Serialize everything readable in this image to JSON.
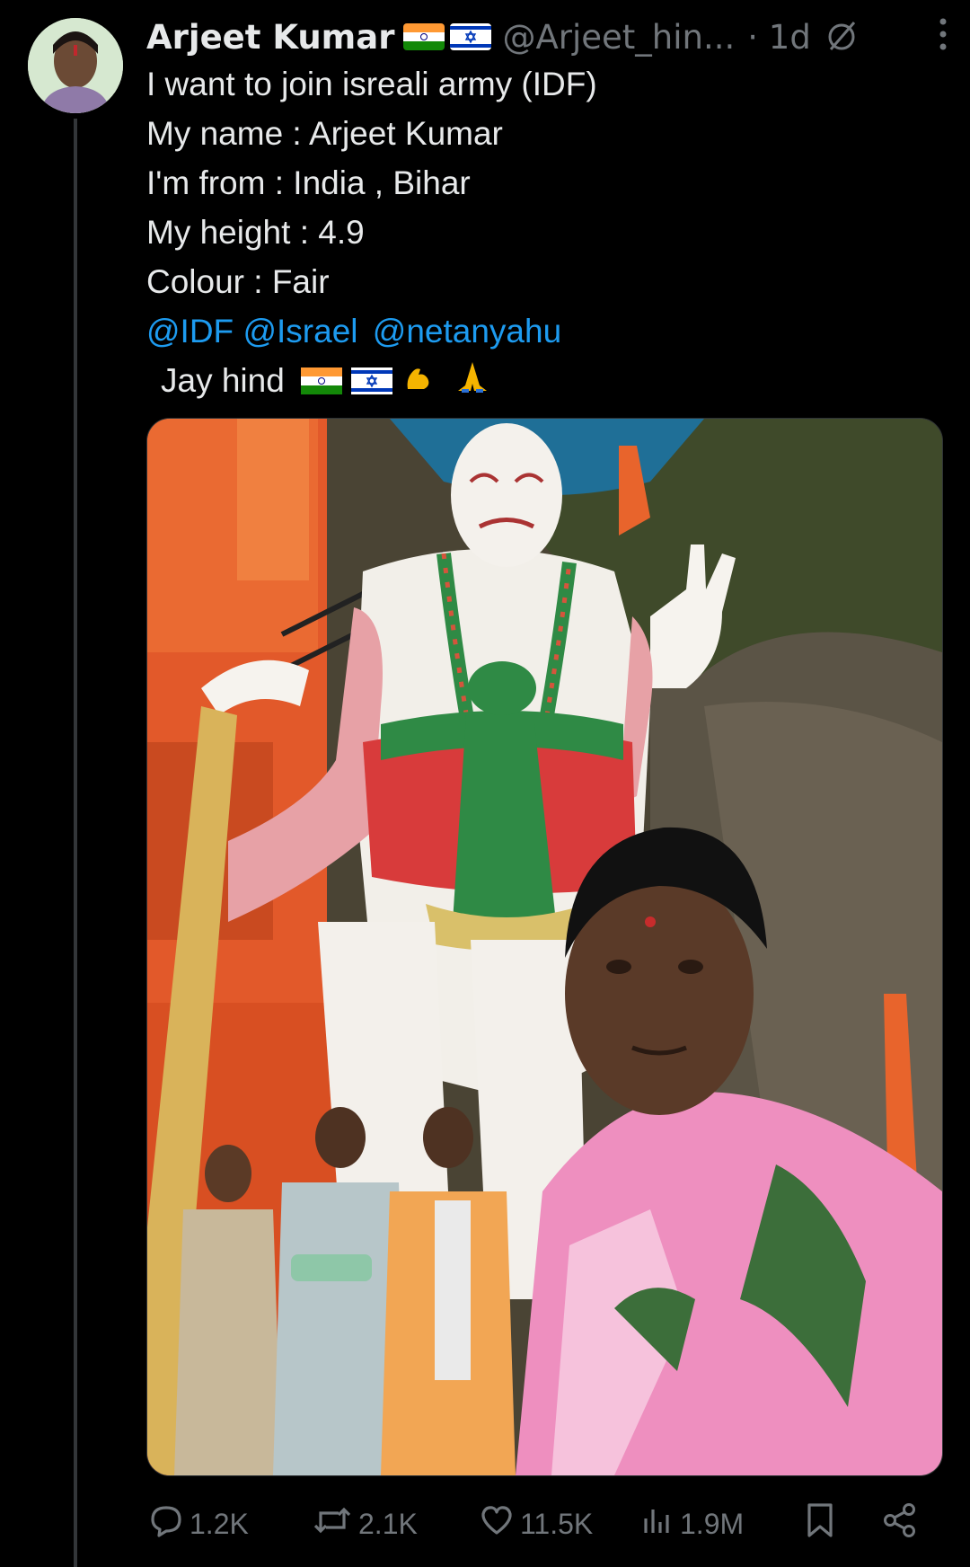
{
  "tweet": {
    "display_name": "Arjeet Kumar",
    "handle": "@Arjeet_hin...",
    "time": "· 1d",
    "lines": [
      "I want to join isreali army (IDF)",
      "My name : Arjeet Kumar",
      "I'm from : India , Bihar",
      "My height : 4.9",
      "Colour : Fair"
    ],
    "mentions": [
      "@IDF",
      "@Israel",
      "@netanyahu"
    ],
    "closing": "Jay hind"
  },
  "icons": {
    "header": [
      "india-flag-icon",
      "israel-flag-icon",
      "grok-icon",
      "more-icon"
    ],
    "closing_emoji": [
      "india-flag-icon",
      "israel-flag-icon",
      "flexed-biceps-icon",
      "folded-hands-icon"
    ],
    "actions": [
      "reply-icon",
      "retweet-icon",
      "like-icon",
      "views-icon",
      "bookmark-icon",
      "share-icon"
    ]
  },
  "actions": {
    "replies": "1.2K",
    "retweets": "2.1K",
    "likes": "11.5K",
    "views": "1.9M"
  },
  "colors": {
    "background": "#000000",
    "text": "#e7e9ea",
    "muted": "#71767b",
    "link": "#1d9bf0"
  }
}
